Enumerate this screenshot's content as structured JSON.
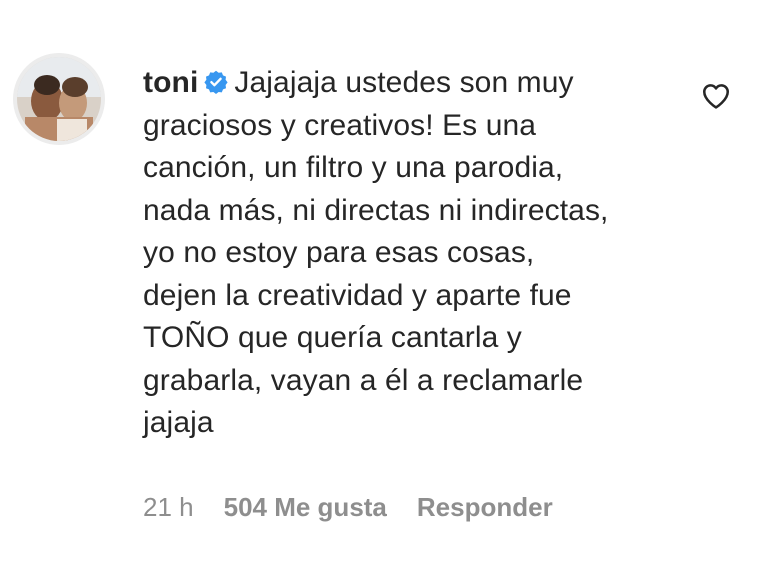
{
  "comment": {
    "username": "toni",
    "verified": true,
    "text": "Jajajaja ustedes son muy\ngraciosos y creativos! Es una\ncanción, un filtro y una parodia,\nnada más, ni directas ni indirectas,\nyo no estoy para esas cosas,\ndejen la creatividad y aparte fue\nTOÑO que quería cantarla y\ngrabarla, vayan a él a reclamarle\njajaja",
    "time": "21 h",
    "likes": "504 Me gusta",
    "reply_label": "Responder",
    "like_icon": "heart-outline-icon",
    "verified_icon": "verified-badge-icon"
  },
  "colors": {
    "text": "#262626",
    "muted": "#8e8e8e",
    "verified": "#3897f0"
  }
}
